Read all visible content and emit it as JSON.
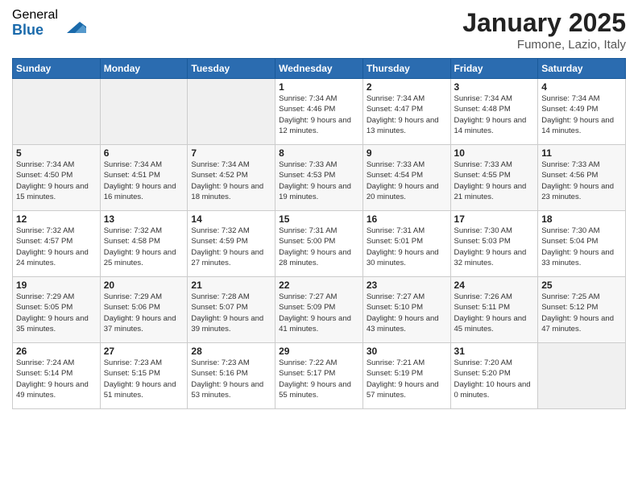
{
  "logo": {
    "general": "General",
    "blue": "Blue"
  },
  "header": {
    "month": "January 2025",
    "location": "Fumone, Lazio, Italy"
  },
  "days_of_week": [
    "Sunday",
    "Monday",
    "Tuesday",
    "Wednesday",
    "Thursday",
    "Friday",
    "Saturday"
  ],
  "weeks": [
    [
      {
        "day": "",
        "empty": true
      },
      {
        "day": "",
        "empty": true
      },
      {
        "day": "",
        "empty": true
      },
      {
        "day": "1",
        "sunrise": "7:34 AM",
        "sunset": "4:46 PM",
        "daylight": "9 hours and 12 minutes."
      },
      {
        "day": "2",
        "sunrise": "7:34 AM",
        "sunset": "4:47 PM",
        "daylight": "9 hours and 13 minutes."
      },
      {
        "day": "3",
        "sunrise": "7:34 AM",
        "sunset": "4:48 PM",
        "daylight": "9 hours and 14 minutes."
      },
      {
        "day": "4",
        "sunrise": "7:34 AM",
        "sunset": "4:49 PM",
        "daylight": "9 hours and 14 minutes."
      }
    ],
    [
      {
        "day": "5",
        "sunrise": "7:34 AM",
        "sunset": "4:50 PM",
        "daylight": "9 hours and 15 minutes."
      },
      {
        "day": "6",
        "sunrise": "7:34 AM",
        "sunset": "4:51 PM",
        "daylight": "9 hours and 16 minutes."
      },
      {
        "day": "7",
        "sunrise": "7:34 AM",
        "sunset": "4:52 PM",
        "daylight": "9 hours and 18 minutes."
      },
      {
        "day": "8",
        "sunrise": "7:33 AM",
        "sunset": "4:53 PM",
        "daylight": "9 hours and 19 minutes."
      },
      {
        "day": "9",
        "sunrise": "7:33 AM",
        "sunset": "4:54 PM",
        "daylight": "9 hours and 20 minutes."
      },
      {
        "day": "10",
        "sunrise": "7:33 AM",
        "sunset": "4:55 PM",
        "daylight": "9 hours and 21 minutes."
      },
      {
        "day": "11",
        "sunrise": "7:33 AM",
        "sunset": "4:56 PM",
        "daylight": "9 hours and 23 minutes."
      }
    ],
    [
      {
        "day": "12",
        "sunrise": "7:32 AM",
        "sunset": "4:57 PM",
        "daylight": "9 hours and 24 minutes."
      },
      {
        "day": "13",
        "sunrise": "7:32 AM",
        "sunset": "4:58 PM",
        "daylight": "9 hours and 25 minutes."
      },
      {
        "day": "14",
        "sunrise": "7:32 AM",
        "sunset": "4:59 PM",
        "daylight": "9 hours and 27 minutes."
      },
      {
        "day": "15",
        "sunrise": "7:31 AM",
        "sunset": "5:00 PM",
        "daylight": "9 hours and 28 minutes."
      },
      {
        "day": "16",
        "sunrise": "7:31 AM",
        "sunset": "5:01 PM",
        "daylight": "9 hours and 30 minutes."
      },
      {
        "day": "17",
        "sunrise": "7:30 AM",
        "sunset": "5:03 PM",
        "daylight": "9 hours and 32 minutes."
      },
      {
        "day": "18",
        "sunrise": "7:30 AM",
        "sunset": "5:04 PM",
        "daylight": "9 hours and 33 minutes."
      }
    ],
    [
      {
        "day": "19",
        "sunrise": "7:29 AM",
        "sunset": "5:05 PM",
        "daylight": "9 hours and 35 minutes."
      },
      {
        "day": "20",
        "sunrise": "7:29 AM",
        "sunset": "5:06 PM",
        "daylight": "9 hours and 37 minutes."
      },
      {
        "day": "21",
        "sunrise": "7:28 AM",
        "sunset": "5:07 PM",
        "daylight": "9 hours and 39 minutes."
      },
      {
        "day": "22",
        "sunrise": "7:27 AM",
        "sunset": "5:09 PM",
        "daylight": "9 hours and 41 minutes."
      },
      {
        "day": "23",
        "sunrise": "7:27 AM",
        "sunset": "5:10 PM",
        "daylight": "9 hours and 43 minutes."
      },
      {
        "day": "24",
        "sunrise": "7:26 AM",
        "sunset": "5:11 PM",
        "daylight": "9 hours and 45 minutes."
      },
      {
        "day": "25",
        "sunrise": "7:25 AM",
        "sunset": "5:12 PM",
        "daylight": "9 hours and 47 minutes."
      }
    ],
    [
      {
        "day": "26",
        "sunrise": "7:24 AM",
        "sunset": "5:14 PM",
        "daylight": "9 hours and 49 minutes."
      },
      {
        "day": "27",
        "sunrise": "7:23 AM",
        "sunset": "5:15 PM",
        "daylight": "9 hours and 51 minutes."
      },
      {
        "day": "28",
        "sunrise": "7:23 AM",
        "sunset": "5:16 PM",
        "daylight": "9 hours and 53 minutes."
      },
      {
        "day": "29",
        "sunrise": "7:22 AM",
        "sunset": "5:17 PM",
        "daylight": "9 hours and 55 minutes."
      },
      {
        "day": "30",
        "sunrise": "7:21 AM",
        "sunset": "5:19 PM",
        "daylight": "9 hours and 57 minutes."
      },
      {
        "day": "31",
        "sunrise": "7:20 AM",
        "sunset": "5:20 PM",
        "daylight": "10 hours and 0 minutes."
      },
      {
        "day": "",
        "empty": true
      }
    ]
  ]
}
